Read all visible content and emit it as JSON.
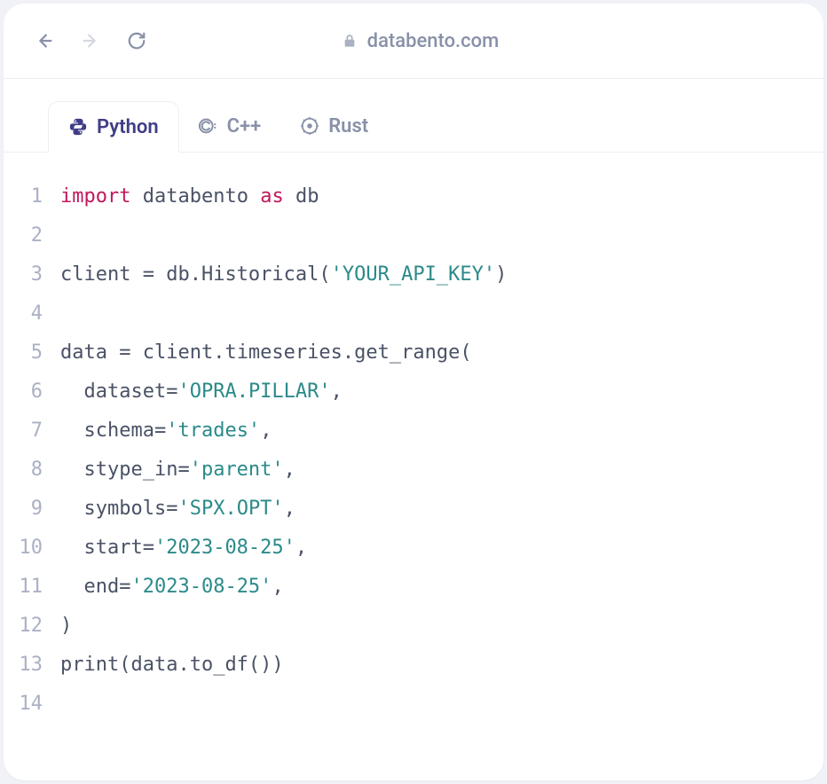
{
  "browser": {
    "url": "databento.com"
  },
  "tabs": [
    {
      "label": "Python",
      "active": true
    },
    {
      "label": "C++",
      "active": false
    },
    {
      "label": "Rust",
      "active": false
    }
  ],
  "code": {
    "language": "python",
    "lines": [
      {
        "num": "1",
        "tokens": [
          {
            "t": "kw",
            "v": "import"
          },
          {
            "t": "sp",
            "v": " "
          },
          {
            "t": "id",
            "v": "databento"
          },
          {
            "t": "sp",
            "v": " "
          },
          {
            "t": "kw",
            "v": "as"
          },
          {
            "t": "sp",
            "v": " "
          },
          {
            "t": "id",
            "v": "db"
          }
        ]
      },
      {
        "num": "2",
        "tokens": []
      },
      {
        "num": "3",
        "tokens": [
          {
            "t": "id",
            "v": "client "
          },
          {
            "t": "op",
            "v": "="
          },
          {
            "t": "id",
            "v": " db.Historical("
          },
          {
            "t": "str",
            "v": "'YOUR_API_KEY'"
          },
          {
            "t": "id",
            "v": ")"
          }
        ]
      },
      {
        "num": "4",
        "tokens": []
      },
      {
        "num": "5",
        "tokens": [
          {
            "t": "id",
            "v": "data "
          },
          {
            "t": "op",
            "v": "="
          },
          {
            "t": "id",
            "v": " client.timeseries.get_range("
          }
        ]
      },
      {
        "num": "6",
        "tokens": [
          {
            "t": "id",
            "v": "  dataset"
          },
          {
            "t": "op",
            "v": "="
          },
          {
            "t": "str",
            "v": "'OPRA.PILLAR'"
          },
          {
            "t": "id",
            "v": ","
          }
        ]
      },
      {
        "num": "7",
        "tokens": [
          {
            "t": "id",
            "v": "  schema"
          },
          {
            "t": "op",
            "v": "="
          },
          {
            "t": "str",
            "v": "'trades'"
          },
          {
            "t": "id",
            "v": ","
          }
        ]
      },
      {
        "num": "8",
        "tokens": [
          {
            "t": "id",
            "v": "  stype_in"
          },
          {
            "t": "op",
            "v": "="
          },
          {
            "t": "str",
            "v": "'parent'"
          },
          {
            "t": "id",
            "v": ","
          }
        ]
      },
      {
        "num": "9",
        "tokens": [
          {
            "t": "id",
            "v": "  symbols"
          },
          {
            "t": "op",
            "v": "="
          },
          {
            "t": "str",
            "v": "'SPX.OPT'"
          },
          {
            "t": "id",
            "v": ","
          }
        ]
      },
      {
        "num": "10",
        "tokens": [
          {
            "t": "id",
            "v": "  start"
          },
          {
            "t": "op",
            "v": "="
          },
          {
            "t": "str",
            "v": "'2023-08-25'"
          },
          {
            "t": "id",
            "v": ","
          }
        ]
      },
      {
        "num": "11",
        "tokens": [
          {
            "t": "id",
            "v": "  end"
          },
          {
            "t": "op",
            "v": "="
          },
          {
            "t": "str",
            "v": "'2023-08-25'"
          },
          {
            "t": "id",
            "v": ","
          }
        ]
      },
      {
        "num": "12",
        "tokens": [
          {
            "t": "id",
            "v": ")"
          }
        ]
      },
      {
        "num": "13",
        "tokens": [
          {
            "t": "id",
            "v": "print"
          },
          {
            "t": "id",
            "v": "(data.to_df())"
          }
        ]
      },
      {
        "num": "14",
        "tokens": []
      }
    ]
  }
}
